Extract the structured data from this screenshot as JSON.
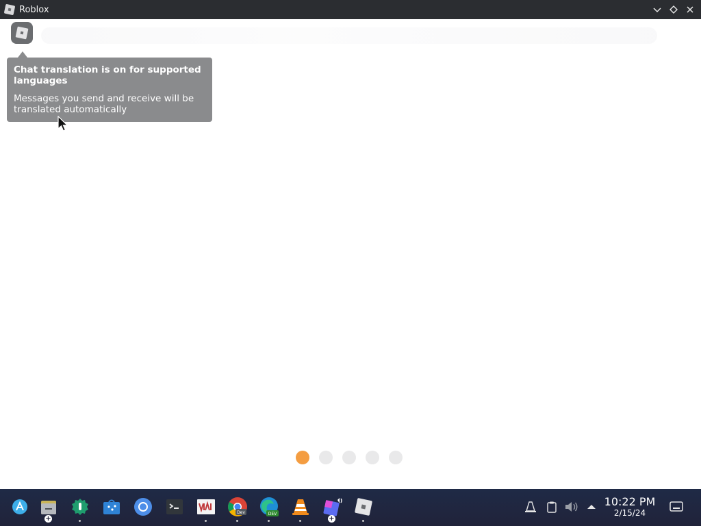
{
  "window": {
    "title": "Roblox"
  },
  "tooltip": {
    "title": "Chat translation is on for supported languages",
    "body": "Messages you send and receive will be translated automatically"
  },
  "carousel": {
    "pages": 5,
    "active_index": 0,
    "active_color": "#f49d41",
    "inactive_color": "#e9e9ea"
  },
  "taskbar": {
    "apps": [
      {
        "name": "launcher-icon"
      },
      {
        "name": "files-icon"
      },
      {
        "name": "plasma-tools-icon"
      },
      {
        "name": "discover-store-icon"
      },
      {
        "name": "chromium-icon"
      },
      {
        "name": "terminal-icon"
      },
      {
        "name": "vivaldi-icon"
      },
      {
        "name": "chrome-dev-icon",
        "badge": "Dev"
      },
      {
        "name": "edge-dev-icon",
        "badge": "DEV"
      },
      {
        "name": "vlc-icon"
      },
      {
        "name": "roblox-studio-icon"
      },
      {
        "name": "roblox-icon"
      }
    ],
    "clock": {
      "time": "10:22 PM",
      "date": "2/15/24"
    }
  },
  "colors": {
    "titlebar": "#2b2d31",
    "taskbar": "#20233a",
    "tooltip_bg": "#8a8b8d"
  }
}
